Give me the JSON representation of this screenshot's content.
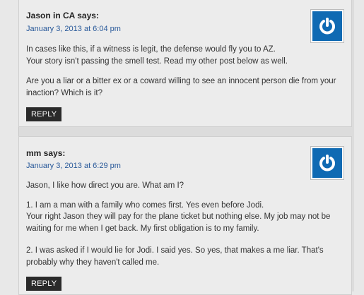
{
  "comments": [
    {
      "author": "Jason in CA says:",
      "date": "January 3, 2013 at 6:04 pm",
      "paragraphs": [
        "In cases like this, if a witness is legit, the defense would fly you to AZ. Your story isn't passing the smell test. Read my other post below as well.",
        "Are you a liar or a bitter ex or a coward willing to see an innocent person die from your inaction? Which is it?"
      ],
      "reply_label": "REPLY",
      "avatar_icon": "power-icon"
    },
    {
      "author": "mm says:",
      "date": "January 3, 2013 at 6:29 pm",
      "paragraphs": [
        "Jason, I like how direct you are. What am I?",
        "1. I am a man with a family who comes first. Yes even before Jodi.",
        "Your right Jason they will pay for the plane ticket but nothing else. My job may not be waiting for me when I get back. My first obligation is to my family.",
        "2. I was asked if I would lie for Jodi. I said yes. So yes, that makes a me liar. That's probably why they haven't called me."
      ],
      "reply_label": "REPLY",
      "avatar_icon": "power-icon"
    }
  ],
  "colors": {
    "link": "#2a5a9a",
    "avatar": "#0f6ab3",
    "reply_bg": "#2a2a2a"
  }
}
